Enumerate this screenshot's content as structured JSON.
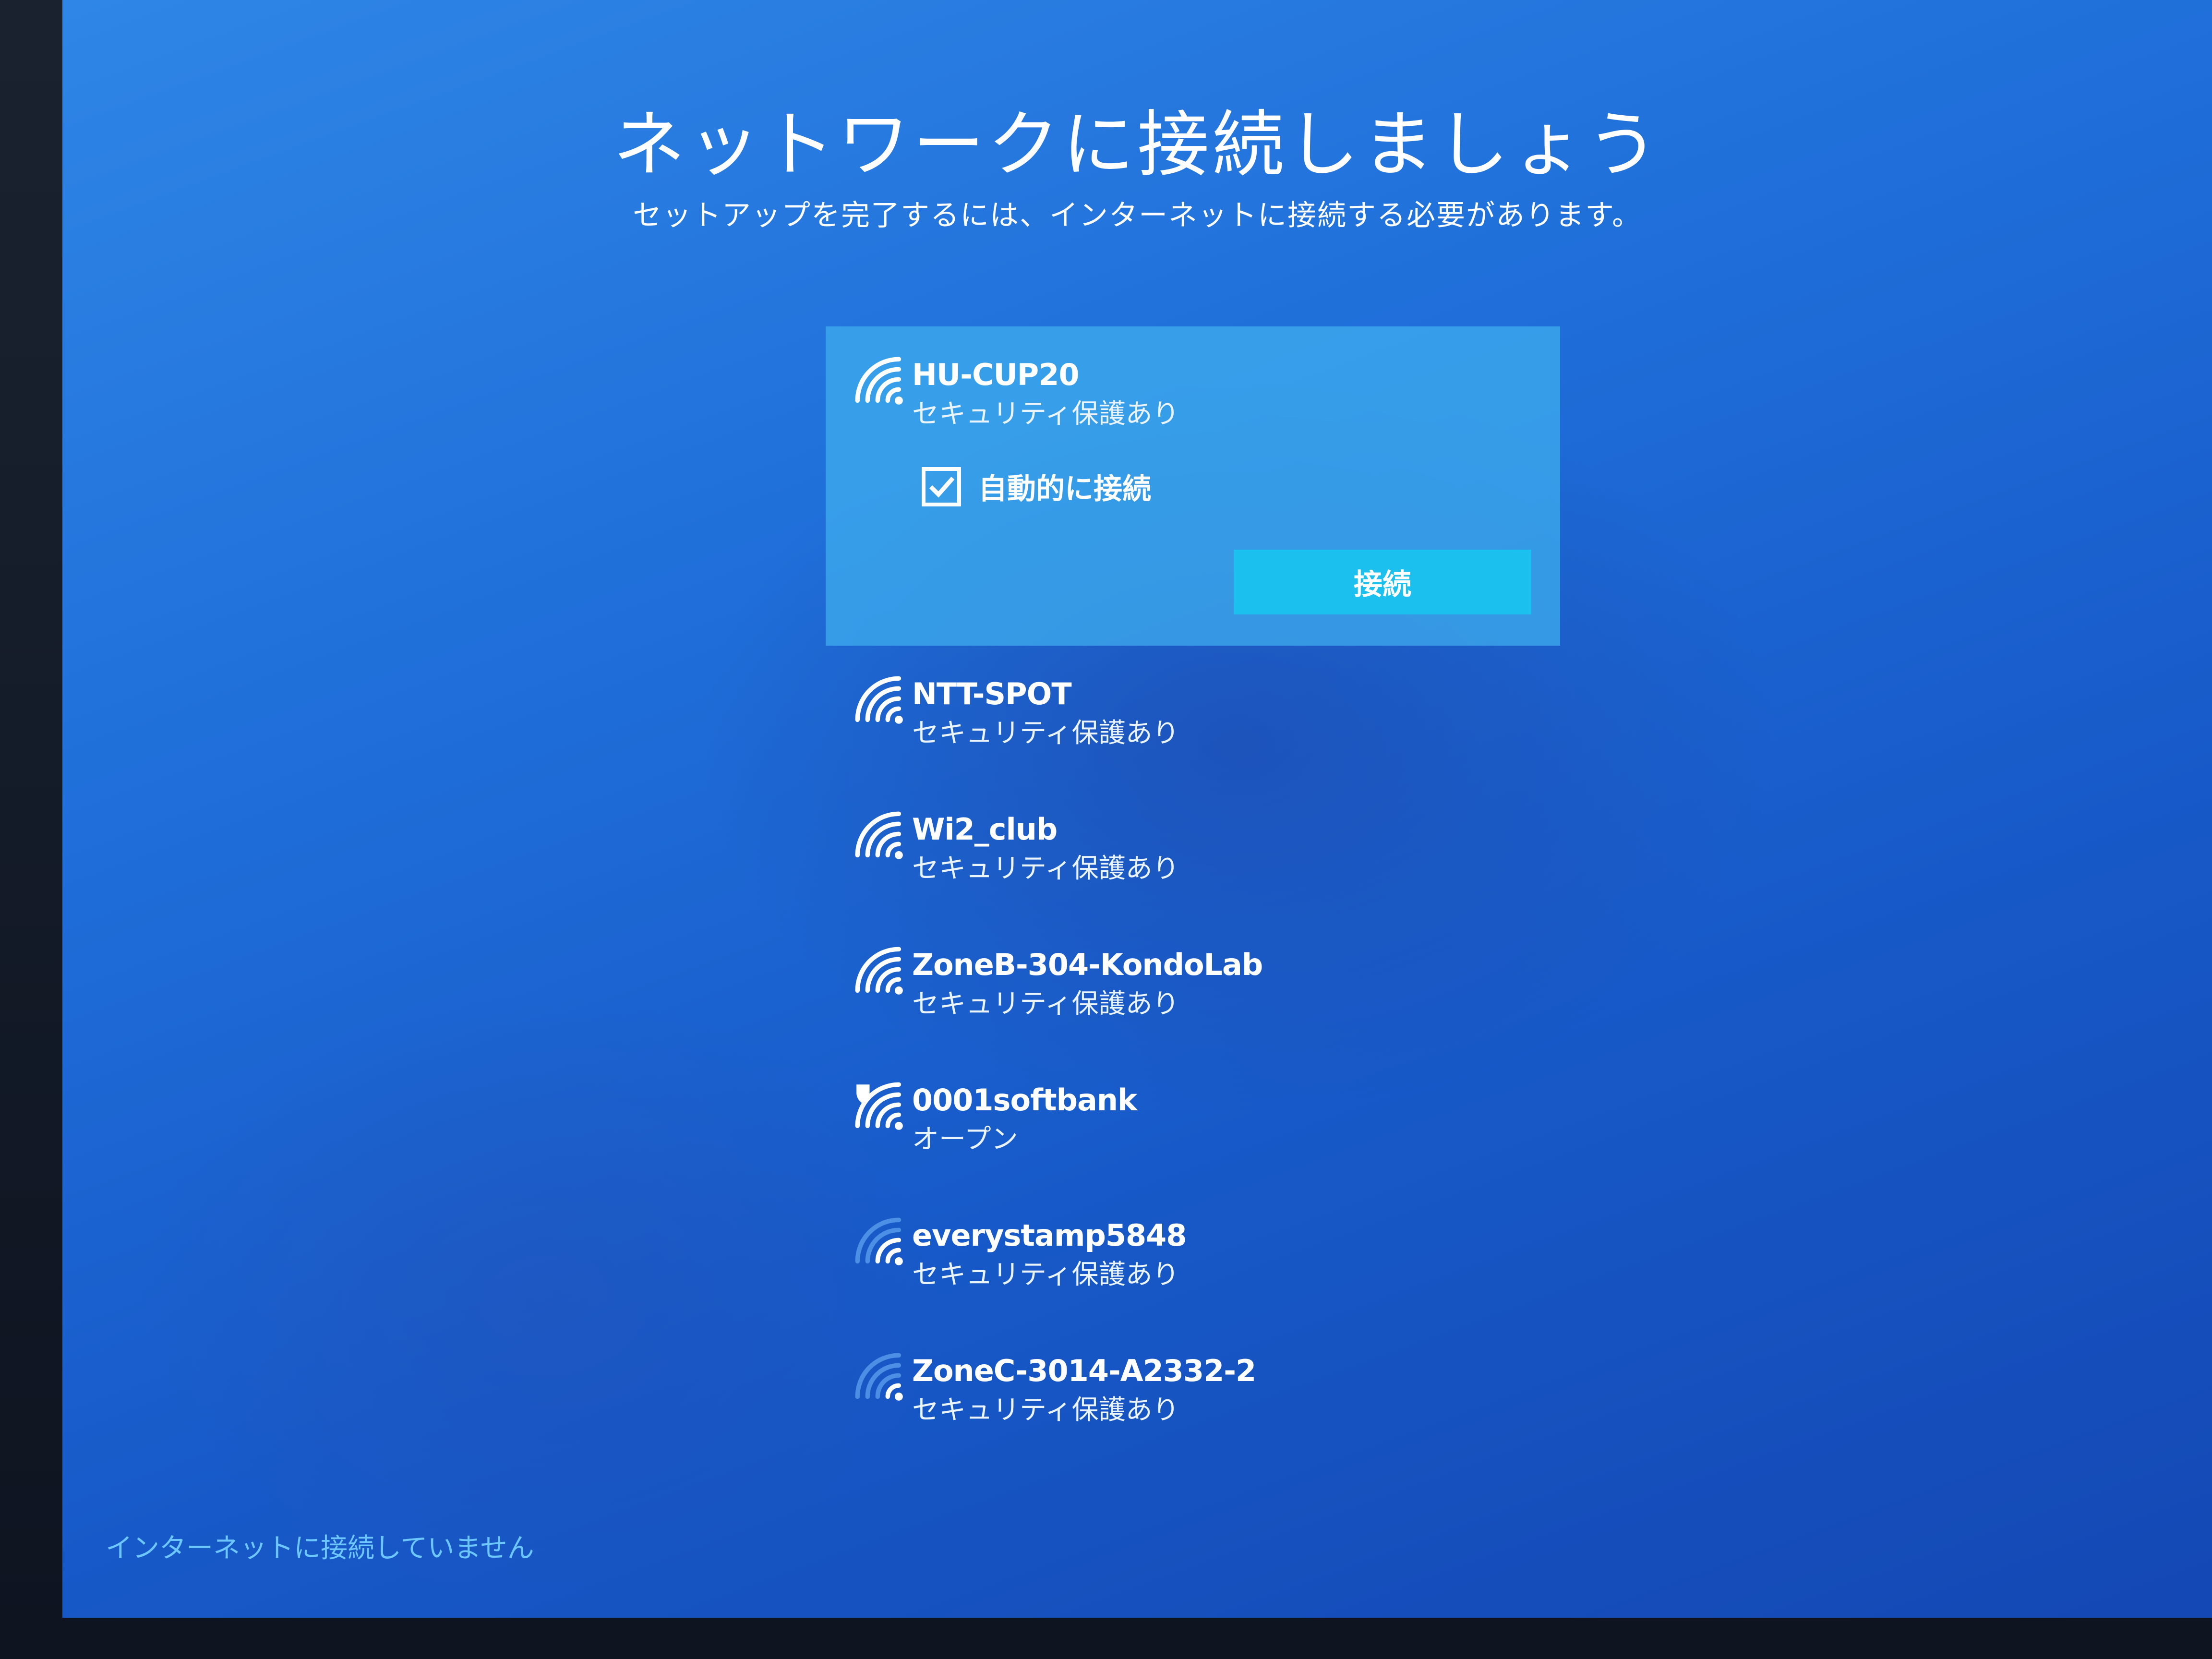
{
  "setup": {
    "title": "ネットワークに接続しましょう",
    "subtitle": "セットアップを完了するには、インターネットに接続する必要があります。"
  },
  "networks": [
    {
      "name": "HU-CUP20",
      "status": "セキュリティ保護あり",
      "signal_bars": 4,
      "icon": "wifi-secured-icon"
    },
    {
      "name": "NTT-SPOT",
      "status": "セキュリティ保護あり",
      "signal_bars": 4,
      "icon": "wifi-secured-icon"
    },
    {
      "name": "Wi2_club",
      "status": "セキュリティ保護あり",
      "signal_bars": 4,
      "icon": "wifi-secured-icon"
    },
    {
      "name": "ZoneB-304-KondoLab",
      "status": "セキュリティ保護あり",
      "signal_bars": 4,
      "icon": "wifi-secured-icon"
    },
    {
      "name": "0001softbank",
      "status": "オープン",
      "signal_bars": 4,
      "icon": "wifi-open-icon"
    },
    {
      "name": "everystamp5848",
      "status": "セキュリティ保護あり",
      "signal_bars": 2,
      "icon": "wifi-secured-icon"
    },
    {
      "name": "ZoneC-3014-A2332-2",
      "status": "セキュリティ保護あり",
      "signal_bars": 1,
      "icon": "wifi-secured-icon"
    }
  ],
  "selected_network": {
    "auto_connect_label": "自動的に接続",
    "auto_connect_checked": true,
    "connect_button_label": "接続"
  },
  "footer": {
    "status": "インターネットに接続していません"
  },
  "colors": {
    "background": "#1f6ed9",
    "selected_item": "#40b0f0",
    "connect_button": "#1cc0ef",
    "footer_text": "#6cc6ff"
  }
}
